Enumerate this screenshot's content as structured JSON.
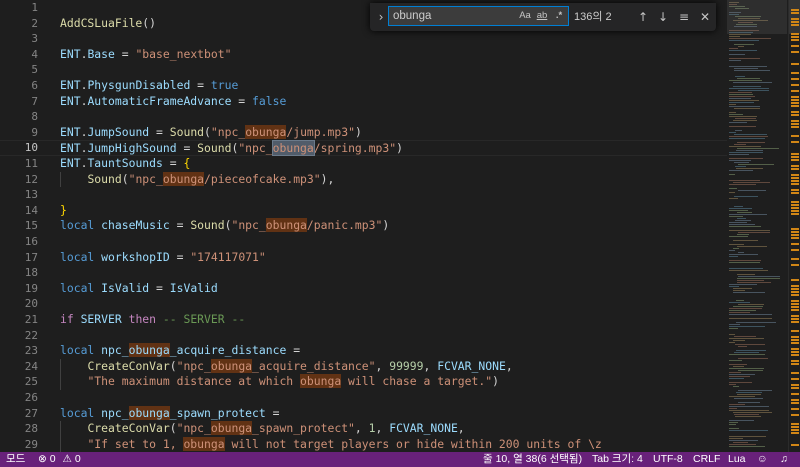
{
  "editor": {
    "current_line": 10,
    "line_numbers": [
      "1",
      "2",
      "3",
      "4",
      "5",
      "6",
      "7",
      "8",
      "9",
      "10",
      "11",
      "12",
      "13",
      "14",
      "15",
      "16",
      "17",
      "18",
      "19",
      "20",
      "21",
      "22",
      "23",
      "24",
      "25",
      "26",
      "27",
      "28",
      "29"
    ]
  },
  "find_widget": {
    "toggle_icon": "chevron-right-icon",
    "query": "obunga",
    "match_case_label": "Aa",
    "whole_word_label": "ab",
    "regex_label": ".*",
    "match_count": "136의 2",
    "prev_icon": "arrow-up-icon",
    "next_icon": "arrow-down-icon",
    "selection_icon": "lines-icon",
    "close_icon": "close-icon"
  },
  "colors": {
    "status_bar": "#68217a",
    "editor_bg": "#1e1e1e",
    "match_highlight": "#613214",
    "current_match": "#515c6a"
  },
  "status_bar": {
    "mode": "모드",
    "errors": "0",
    "warnings": "0",
    "position": "줄 10, 열 38(6 선택됨)",
    "tab_size": "Tab 크기: 4",
    "encoding": "UTF-8",
    "eol": "CRLF",
    "language": "Lua",
    "feedback_icon": "feedback-icon",
    "bell_icon": "bell-icon"
  }
}
